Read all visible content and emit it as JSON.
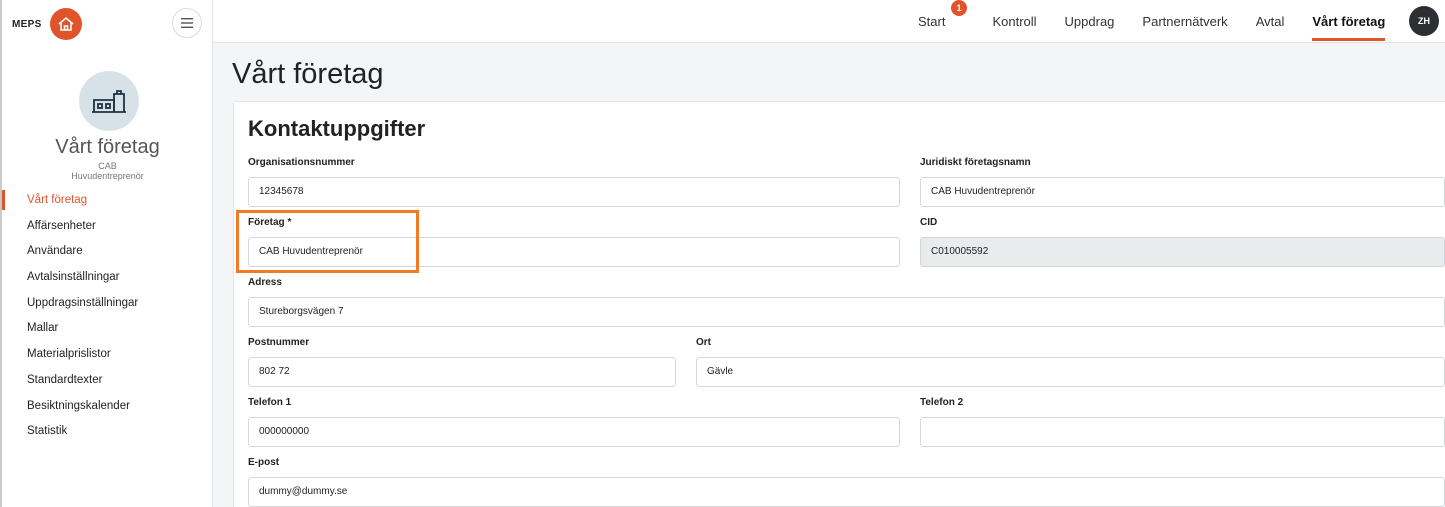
{
  "brand": {
    "name": "MEPS"
  },
  "company": {
    "title": "Vårt företag",
    "subtitle": "CAB Huvudentreprenör"
  },
  "sidebar": {
    "items": [
      {
        "label": "Vårt företag"
      },
      {
        "label": "Affärsenheter"
      },
      {
        "label": "Användare"
      },
      {
        "label": "Avtalsinställningar"
      },
      {
        "label": "Uppdragsinställningar"
      },
      {
        "label": "Mallar"
      },
      {
        "label": "Materialprislistor"
      },
      {
        "label": "Standardtexter"
      },
      {
        "label": "Besiktningskalender"
      },
      {
        "label": "Statistik"
      }
    ]
  },
  "topnav": {
    "items": [
      {
        "label": "Start",
        "badge": "1"
      },
      {
        "label": "Kontroll"
      },
      {
        "label": "Uppdrag"
      },
      {
        "label": "Partnernätverk"
      },
      {
        "label": "Avtal"
      },
      {
        "label": "Vårt företag"
      }
    ],
    "user_initials": "ZH"
  },
  "page": {
    "title": "Vårt företag"
  },
  "form": {
    "title": "Kontaktuppgifter",
    "org_nr": {
      "label": "Organisationsnummer",
      "value": "12345678"
    },
    "legal_name": {
      "label": "Juridiskt företagsnamn",
      "value": "CAB Huvudentreprenör"
    },
    "company": {
      "label": "Företag *",
      "value": "CAB Huvudentreprenör"
    },
    "cid": {
      "label": "CID",
      "value": "C010005592"
    },
    "address": {
      "label": "Adress",
      "value": "Stureborgsvägen 7"
    },
    "postal_code": {
      "label": "Postnummer",
      "value": "802 72"
    },
    "city": {
      "label": "Ort",
      "value": "Gävle"
    },
    "phone1": {
      "label": "Telefon 1",
      "value": "000000000"
    },
    "phone2": {
      "label": "Telefon 2",
      "value": ""
    },
    "email": {
      "label": "E-post",
      "value": "dummy@dummy.se"
    }
  },
  "colors": {
    "accent": "#e0542b",
    "highlight": "#f07b24"
  }
}
